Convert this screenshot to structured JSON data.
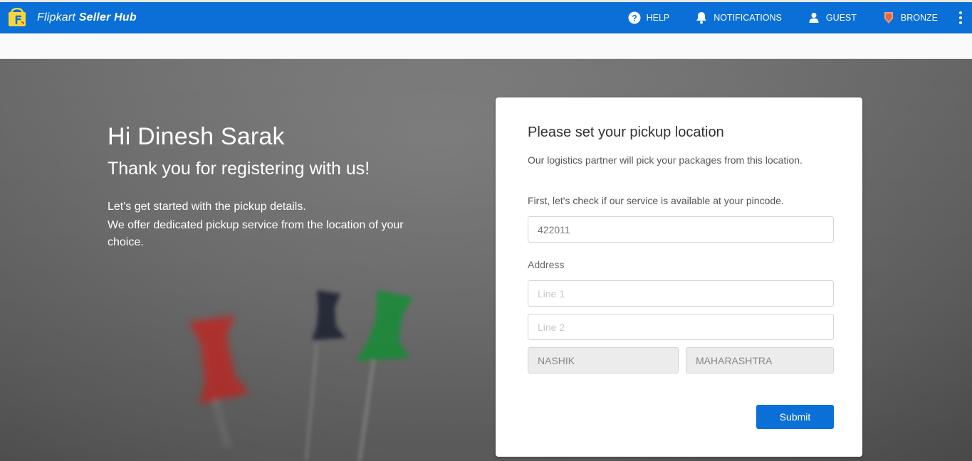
{
  "header": {
    "brand_prefix": "Flipkart",
    "brand_suffix": "Seller Hub",
    "brand_color": "#0a6fd6",
    "nav": {
      "help": "HELP",
      "notifications": "NOTIFICATIONS",
      "guest": "GUEST",
      "bronze": "BRONZE"
    }
  },
  "hero": {
    "name_line": "Hi Dinesh Sarak",
    "thanks_line": "Thank you for registering with us!",
    "line1": "Let's get started with the pickup details.",
    "line2": "We offer dedicated pickup service from the location of your choice."
  },
  "card": {
    "title": "Please set your pickup location",
    "description": "Our logistics partner will pick your packages from this location.",
    "check_text": "First, let's check if our service is available at your pincode.",
    "pincode_value": "422011",
    "address_label": "Address",
    "line1_placeholder": "Line 1",
    "line2_placeholder": "Line 2",
    "city_value": "NASHIK",
    "state_value": "MAHARASHTRA",
    "submit_label": "Submit"
  }
}
